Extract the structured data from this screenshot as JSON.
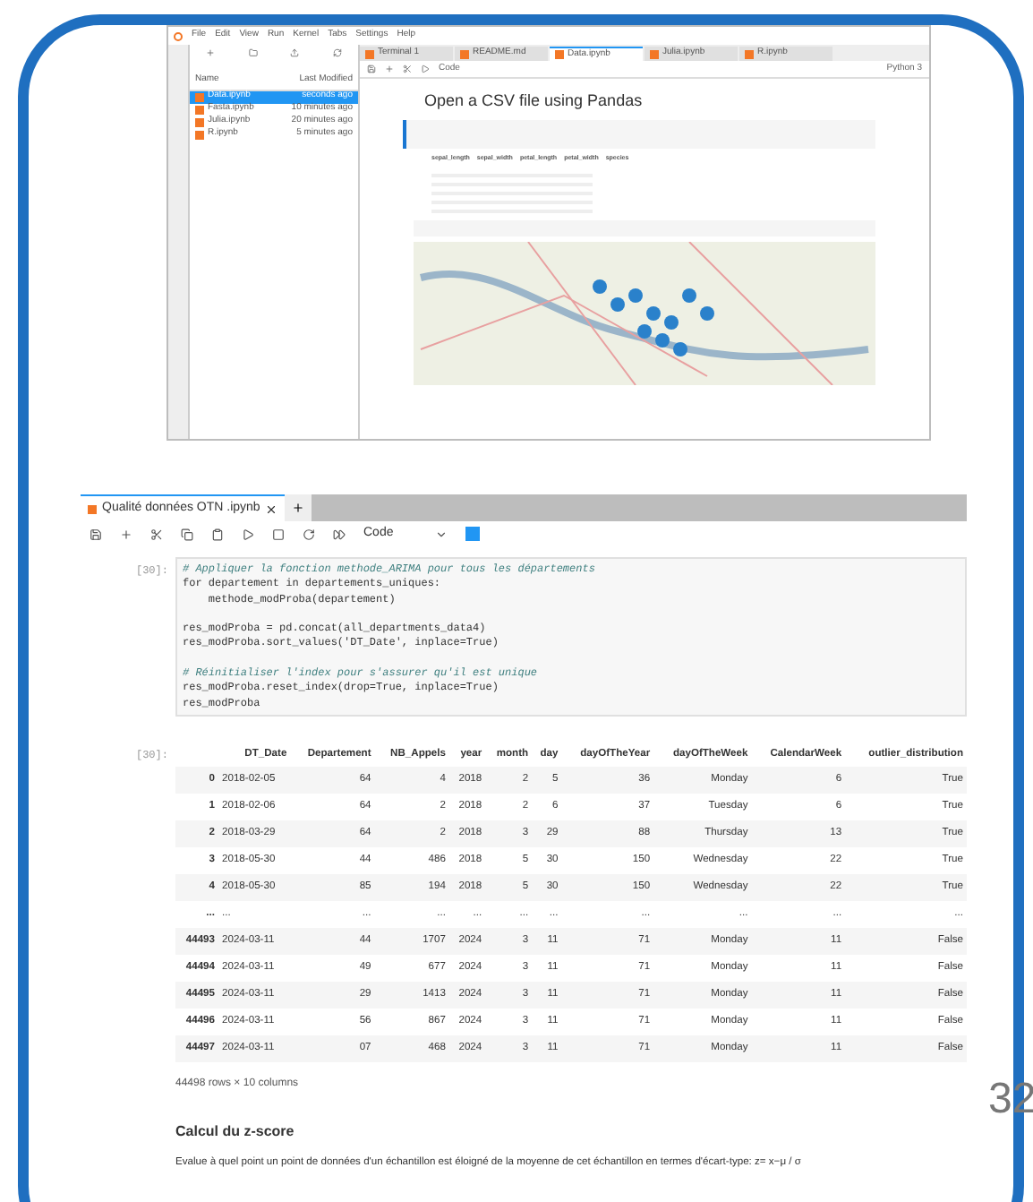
{
  "slide": {
    "page_number": "32"
  },
  "top_screenshot": {
    "menu": [
      "File",
      "Edit",
      "View",
      "Run",
      "Kernel",
      "Tabs",
      "Settings",
      "Help"
    ],
    "file_columns": [
      "Name",
      "Last Modified"
    ],
    "files": [
      {
        "name": "Data.ipynb",
        "modified": "seconds ago",
        "selected": true
      },
      {
        "name": "Fasta.ipynb",
        "modified": "10 minutes ago",
        "selected": false
      },
      {
        "name": "Julia.ipynb",
        "modified": "20 minutes ago",
        "selected": false
      },
      {
        "name": "R.ipynb",
        "modified": "5 minutes ago",
        "selected": false
      }
    ],
    "tabs": [
      {
        "label": "Terminal 1",
        "selected": false
      },
      {
        "label": "README.md",
        "selected": false
      },
      {
        "label": "Data.ipynb",
        "selected": true
      },
      {
        "label": "Julia.ipynb",
        "selected": false
      },
      {
        "label": "R.ipynb",
        "selected": false
      }
    ],
    "cell_type": "Code",
    "kernel": "Python 3",
    "heading": "Open a CSV file using Pandas",
    "table_columns": [
      "sepal_length",
      "sepal_width",
      "petal_length",
      "petal_width",
      "species"
    ]
  },
  "notebook": {
    "tab": {
      "title": "Qualité données OTN .ipynb"
    },
    "cell_type": "Code",
    "code_cell": {
      "prompt": "[30]:",
      "lines": [
        {
          "kind": "comment",
          "text": "# Appliquer la fonction methode_ARIMA pour tous les départements"
        },
        {
          "kind": "code",
          "text": "for departement in departements_uniques:"
        },
        {
          "kind": "code",
          "text": "    methode_modProba(departement)"
        },
        {
          "kind": "blank"
        },
        {
          "kind": "code",
          "text": "res_modProba = pd.concat(all_departments_data4)"
        },
        {
          "kind": "code",
          "text": "res_modProba.sort_values('DT_Date', inplace=True)"
        },
        {
          "kind": "blank"
        },
        {
          "kind": "comment",
          "text": "# Réinitialiser l'index pour s'assurer qu'il est unique"
        },
        {
          "kind": "code",
          "text": "res_modProba.reset_index(drop=True, inplace=True)"
        },
        {
          "kind": "code",
          "text": "res_modProba"
        }
      ]
    },
    "output": {
      "prompt": "[30]:",
      "columns": [
        "DT_Date",
        "Departement",
        "NB_Appels",
        "year",
        "month",
        "day",
        "dayOfTheYear",
        "dayOfTheWeek",
        "CalendarWeek",
        "outlier_distribution"
      ],
      "rows": [
        {
          "index": "0",
          "cells": [
            "2018-02-05",
            "64",
            "4",
            "2018",
            "2",
            "5",
            "36",
            "Monday",
            "6",
            "True"
          ]
        },
        {
          "index": "1",
          "cells": [
            "2018-02-06",
            "64",
            "2",
            "2018",
            "2",
            "6",
            "37",
            "Tuesday",
            "6",
            "True"
          ]
        },
        {
          "index": "2",
          "cells": [
            "2018-03-29",
            "64",
            "2",
            "2018",
            "3",
            "29",
            "88",
            "Thursday",
            "13",
            "True"
          ]
        },
        {
          "index": "3",
          "cells": [
            "2018-05-30",
            "44",
            "486",
            "2018",
            "5",
            "30",
            "150",
            "Wednesday",
            "22",
            "True"
          ]
        },
        {
          "index": "4",
          "cells": [
            "2018-05-30",
            "85",
            "194",
            "2018",
            "5",
            "30",
            "150",
            "Wednesday",
            "22",
            "True"
          ]
        },
        {
          "index": "...",
          "cells": [
            "...",
            "...",
            "...",
            "...",
            "...",
            "...",
            "...",
            "...",
            "...",
            "..."
          ]
        },
        {
          "index": "44493",
          "cells": [
            "2024-03-11",
            "44",
            "1707",
            "2024",
            "3",
            "11",
            "71",
            "Monday",
            "11",
            "False"
          ]
        },
        {
          "index": "44494",
          "cells": [
            "2024-03-11",
            "49",
            "677",
            "2024",
            "3",
            "11",
            "71",
            "Monday",
            "11",
            "False"
          ]
        },
        {
          "index": "44495",
          "cells": [
            "2024-03-11",
            "29",
            "1413",
            "2024",
            "3",
            "11",
            "71",
            "Monday",
            "11",
            "False"
          ]
        },
        {
          "index": "44496",
          "cells": [
            "2024-03-11",
            "56",
            "867",
            "2024",
            "3",
            "11",
            "71",
            "Monday",
            "11",
            "False"
          ]
        },
        {
          "index": "44497",
          "cells": [
            "2024-03-11",
            "07",
            "468",
            "2024",
            "3",
            "11",
            "71",
            "Monday",
            "11",
            "False"
          ]
        }
      ],
      "summary": "44498 rows × 10 columns"
    },
    "section_heading": "Calcul du z-score",
    "paragraph": "Evalue à quel point un point de données d'un échantillon est éloigné de la moyenne de cet échantillon en termes d'écart-type: z= x−μ / σ"
  }
}
